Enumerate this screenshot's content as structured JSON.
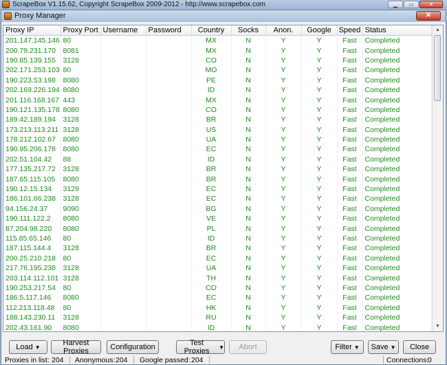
{
  "app": {
    "title": "ScrapeBox V1.15.62, Copyright ScrapeBox 2009-2012 - http://www.scrapebox.com"
  },
  "dialog": {
    "title": "Proxy Manager",
    "close_glyph": "✕"
  },
  "columns": [
    "Proxy IP",
    "Proxy Port",
    "Username",
    "Password",
    "Country",
    "Socks",
    "Anon.",
    "Google",
    "Speed",
    "Status"
  ],
  "rows": [
    [
      "201.147.145.146",
      "80",
      "",
      "",
      "MX",
      "N",
      "Y",
      "Y",
      "Fast",
      "Completed"
    ],
    [
      "200.79.231.170",
      "8081",
      "",
      "",
      "MX",
      "N",
      "Y",
      "Y",
      "Fast",
      "Completed"
    ],
    [
      "190.85.139.155",
      "3128",
      "",
      "",
      "CO",
      "N",
      "Y",
      "Y",
      "Fast",
      "Completed"
    ],
    [
      "202.171.253.103",
      "80",
      "",
      "",
      "MO",
      "N",
      "Y",
      "Y",
      "Fast",
      "Completed"
    ],
    [
      "190.223.53.198",
      "8080",
      "",
      "",
      "PE",
      "N",
      "Y",
      "Y",
      "Fast",
      "Completed"
    ],
    [
      "202.169.226.194",
      "8080",
      "",
      "",
      "ID",
      "N",
      "Y",
      "Y",
      "Fast",
      "Completed"
    ],
    [
      "201.116.168.167",
      "443",
      "",
      "",
      "MX",
      "N",
      "Y",
      "Y",
      "Fast",
      "Completed"
    ],
    [
      "190.121.135.178",
      "8080",
      "",
      "",
      "CO",
      "N",
      "Y",
      "Y",
      "Fast",
      "Completed"
    ],
    [
      "189.42.189.194",
      "3128",
      "",
      "",
      "BR",
      "N",
      "Y",
      "Y",
      "Fast",
      "Completed"
    ],
    [
      "173.213.113.211",
      "3128",
      "",
      "",
      "US",
      "N",
      "Y",
      "Y",
      "Fast",
      "Completed"
    ],
    [
      "178.212.102.67",
      "8080",
      "",
      "",
      "UA",
      "N",
      "Y",
      "Y",
      "Fast",
      "Completed"
    ],
    [
      "190.95.206.178",
      "8080",
      "",
      "",
      "EC",
      "N",
      "Y",
      "Y",
      "Fast",
      "Completed"
    ],
    [
      "202.51.104.42",
      "88",
      "",
      "",
      "ID",
      "N",
      "Y",
      "Y",
      "Fast",
      "Completed"
    ],
    [
      "177.135.217.72",
      "3128",
      "",
      "",
      "BR",
      "N",
      "Y",
      "Y",
      "Fast",
      "Completed"
    ],
    [
      "187.65.115.105",
      "8080",
      "",
      "",
      "BR",
      "N",
      "Y",
      "Y",
      "Fast",
      "Completed"
    ],
    [
      "190.12.15.134",
      "3129",
      "",
      "",
      "EC",
      "N",
      "Y",
      "Y",
      "Fast",
      "Completed"
    ],
    [
      "186.101.66.238",
      "3128",
      "",
      "",
      "EC",
      "N",
      "Y",
      "Y",
      "Fast",
      "Completed"
    ],
    [
      "94.156.24.37",
      "9090",
      "",
      "",
      "BG",
      "N",
      "Y",
      "Y",
      "Fast",
      "Completed"
    ],
    [
      "190.111.122.2",
      "8080",
      "",
      "",
      "VE",
      "N",
      "Y",
      "Y",
      "Fast",
      "Completed"
    ],
    [
      "87.204.98.220",
      "8080",
      "",
      "",
      "PL",
      "N",
      "Y",
      "Y",
      "Fast",
      "Completed"
    ],
    [
      "115.85.65.146",
      "80",
      "",
      "",
      "ID",
      "N",
      "Y",
      "Y",
      "Fast",
      "Completed"
    ],
    [
      "187.115.144.4",
      "3128",
      "",
      "",
      "BR",
      "N",
      "Y",
      "Y",
      "Fast",
      "Completed"
    ],
    [
      "200.25.210.218",
      "80",
      "",
      "",
      "EC",
      "N",
      "Y",
      "Y",
      "Fast",
      "Completed"
    ],
    [
      "217.76.195.238",
      "3128",
      "",
      "",
      "UA",
      "N",
      "Y",
      "Y",
      "Fast",
      "Completed"
    ],
    [
      "203.114.112.101",
      "3128",
      "",
      "",
      "TH",
      "N",
      "Y",
      "Y",
      "Fast",
      "Completed"
    ],
    [
      "190.253.217.54",
      "80",
      "",
      "",
      "CO",
      "N",
      "Y",
      "Y",
      "Fast",
      "Completed"
    ],
    [
      "186.5.117.146",
      "8080",
      "",
      "",
      "EC",
      "N",
      "Y",
      "Y",
      "Fast",
      "Completed"
    ],
    [
      "112.213.118.48",
      "80",
      "",
      "",
      "HK",
      "N",
      "Y",
      "Y",
      "Fast",
      "Completed"
    ],
    [
      "188.143.230.11",
      "3128",
      "",
      "",
      "RU",
      "N",
      "Y",
      "Y",
      "Fast",
      "Completed"
    ],
    [
      "202.43.161.90",
      "8080",
      "",
      "",
      "ID",
      "N",
      "Y",
      "Y",
      "Fast",
      "Completed"
    ]
  ],
  "buttons": {
    "load": "Load",
    "harvest": "Harvest Proxies",
    "configuration": "Configuration",
    "test": "Test Proxies",
    "abort": "Abort",
    "filter": "Filter",
    "save": "Save",
    "close": "Close"
  },
  "status": {
    "proxies_label": "Proxies in list:",
    "proxies_value": "204",
    "anonymous_label": "Anonymous:",
    "anonymous_value": "204",
    "google_label": "Google passed:",
    "google_value": "204",
    "connections_label": "Connections:",
    "connections_value": "0"
  },
  "colors": {
    "row_text": "#1e8a1e",
    "title_gradient_top": "#cddcec",
    "close_red": "#c03a24"
  }
}
